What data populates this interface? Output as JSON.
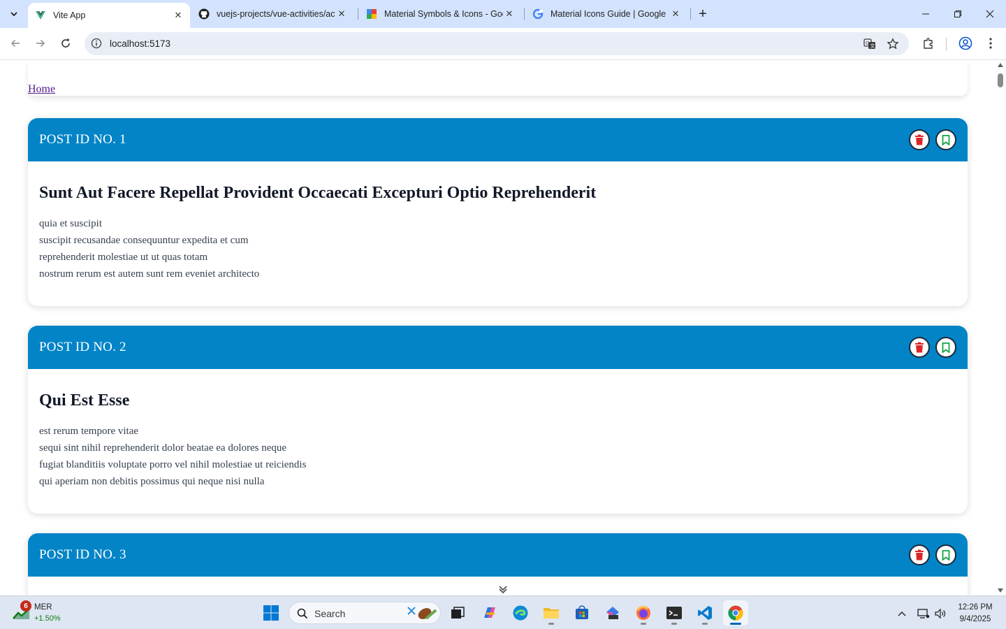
{
  "browser": {
    "tabs": [
      {
        "title": "Vite App",
        "active": true,
        "favicon": "vite-icon"
      },
      {
        "title": "vuejs-projects/vue-activities/ac",
        "active": false,
        "favicon": "github-icon"
      },
      {
        "title": "Material Symbols & Icons - Goo",
        "active": false,
        "favicon": "material-icon"
      },
      {
        "title": "Material Icons Guide  |  Google",
        "active": false,
        "favicon": "google-icon"
      }
    ],
    "url": "localhost:5173"
  },
  "page": {
    "nav": {
      "home_label": "Home"
    },
    "posts": [
      {
        "header": "POST ID NO. 1",
        "title": "Sunt Aut Facere Repellat Provident Occaecati Excepturi Optio Reprehenderit",
        "body": "quia et suscipit\nsuscipit recusandae consequuntur expedita et cum\nreprehenderit molestiae ut ut quas totam\nnostrum rerum est autem sunt rem eveniet architecto"
      },
      {
        "header": "POST ID NO. 2",
        "title": "Qui Est Esse",
        "body": "est rerum tempore vitae\nsequi sint nihil reprehenderit dolor beatae ea dolores neque\nfugiat blanditiis voluptate porro vel nihil molestiae ut reiciendis\nqui aperiam non debitis possimus qui neque nisi nulla"
      },
      {
        "header": "POST ID NO. 3",
        "title": "",
        "body": ""
      }
    ],
    "colors": {
      "header_bg": "#0284c7",
      "delete_icon": "#dc2626",
      "bookmark_icon": "#16a34a"
    }
  },
  "taskbar": {
    "stock": {
      "badge": "6",
      "symbol": "MER",
      "change": "+1.50%"
    },
    "search_label": "Search",
    "clock": {
      "time": "12:26 PM",
      "date": "9/4/2025"
    }
  }
}
